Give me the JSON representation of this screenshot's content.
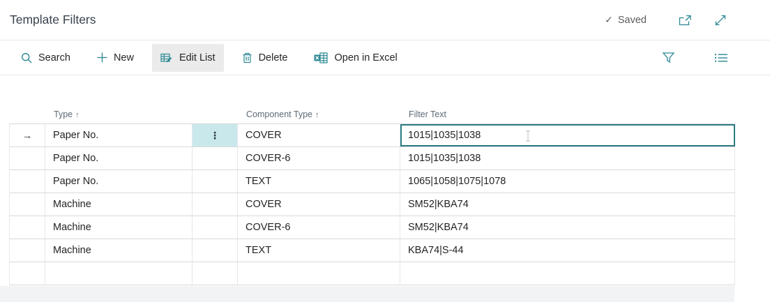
{
  "header": {
    "title": "Template Filters",
    "saved_label": "Saved"
  },
  "toolbar": {
    "search_label": "Search",
    "new_label": "New",
    "edit_list_label": "Edit List",
    "delete_label": "Delete",
    "open_in_excel_label": "Open in Excel"
  },
  "table": {
    "columns": [
      {
        "label": "Type",
        "sort_indicator": "↑"
      },
      {
        "label": "Component Type",
        "sort_indicator": "↑"
      },
      {
        "label": "Filter Text",
        "sort_indicator": ""
      }
    ],
    "rows": [
      {
        "type": "Paper No.",
        "component_type": "COVER",
        "filter_text": "1015|1035|1038",
        "selected": true,
        "filter_cell_focused": true
      },
      {
        "type": "Paper No.",
        "component_type": "COVER-6",
        "filter_text": "1015|1035|1038"
      },
      {
        "type": "Paper No.",
        "component_type": "TEXT",
        "filter_text": "1065|1058|1075|1078"
      },
      {
        "type": "Machine",
        "component_type": "COVER",
        "filter_text": "SM52|KBA74"
      },
      {
        "type": "Machine",
        "component_type": "COVER-6",
        "filter_text": "SM52|KBA74"
      },
      {
        "type": "Machine",
        "component_type": "TEXT",
        "filter_text": "KBA74|S-44"
      }
    ]
  },
  "icons": {
    "saved_check": "✓",
    "selected_row_arrow": "→",
    "row_menu_ellipsis": "⋮"
  },
  "colors": {
    "accent_teal": "#2b8894",
    "focus_border": "#2c7c85",
    "selected_menu_bg": "#c9e8ec",
    "toolbar_active_bg": "#ebebeb",
    "footer_bg": "#f2f3f5"
  }
}
